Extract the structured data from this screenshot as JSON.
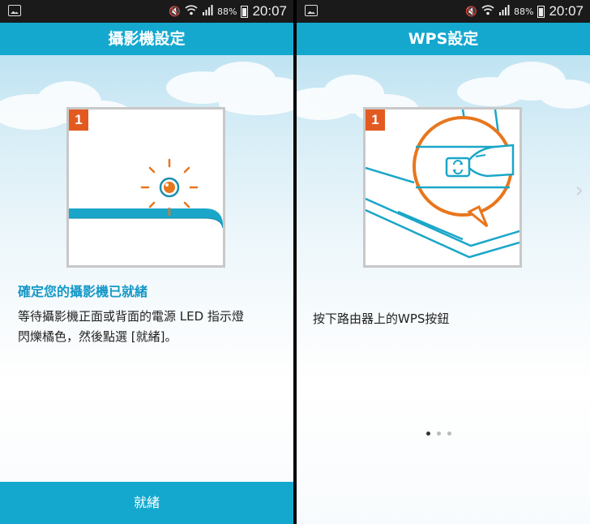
{
  "status_bar": {
    "battery_percent": "88%",
    "time": "20:07"
  },
  "left": {
    "title": "攝影機設定",
    "step_number": "1",
    "heading": "確定您的攝影機已就緒",
    "body_line1": "等待攝影機正面或背面的電源 LED 指示燈",
    "body_line2": "閃爍橘色，然後點選 [就緒]。",
    "button_label": "就緒"
  },
  "right": {
    "title": "WPS設定",
    "step_number": "1",
    "body": "按下路由器上的WPS按鈕",
    "page_indicator": {
      "count": 3,
      "active_index": 0
    }
  },
  "colors": {
    "accent": "#14a8cf",
    "step_badge": "#e35a20",
    "heading": "#1598c7",
    "led": "#e8761d"
  },
  "icons": [
    "gallery-icon",
    "mute-icon",
    "wifi-icon",
    "signal-icon",
    "battery-icon",
    "chevron-right-icon",
    "led-icon",
    "wps-button-icon"
  ]
}
